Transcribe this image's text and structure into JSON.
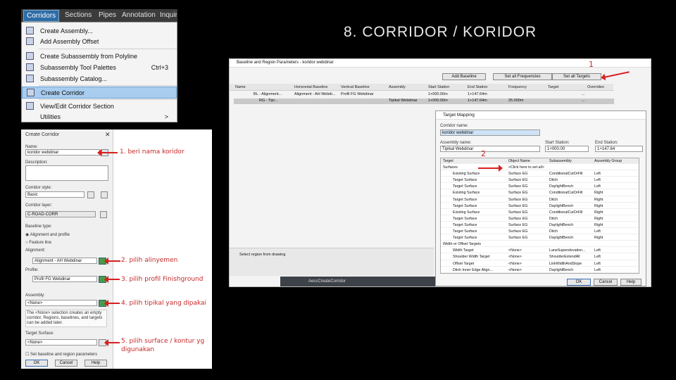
{
  "slide_title": "8. CORRIDOR / KORIDOR",
  "ribbon": {
    "tabs": [
      "Corridors",
      "Sections",
      "Pipes",
      "Annotation",
      "Inquiry"
    ]
  },
  "menu": {
    "items": [
      {
        "label": "Create Assembly...",
        "shortcut": ""
      },
      {
        "label": "Add Assembly Offset",
        "shortcut": ""
      },
      {
        "label": "Create Subassembly from Polyline",
        "shortcut": ""
      },
      {
        "label": "Subassembly Tool Palettes",
        "shortcut": "Ctrl+3"
      },
      {
        "label": "Subassembly Catalog...",
        "shortcut": ""
      },
      {
        "label": "Create Corridor",
        "shortcut": ""
      },
      {
        "label": "View/Edit Corridor Section",
        "shortcut": ""
      },
      {
        "label": "Utilities",
        "shortcut": ">"
      }
    ]
  },
  "create_corridor": {
    "title": "Create Corridor",
    "name_label": "Name:",
    "name_value": "koridor webdinar",
    "description_label": "Description:",
    "style_label": "Corridor style:",
    "style_value": "Basic",
    "layer_label": "Corridor layer:",
    "layer_value": "C-ROAD-CORR",
    "baseline_type_label": "Baseline type:",
    "radio_alignment": "Alignment and profile",
    "radio_feature": "Feature line",
    "alignment_label": "Alignment:",
    "alignment_value": "Alignment - AH Webdinar",
    "profile_label": "Profile:",
    "profile_value": "Profil FG Webdinar",
    "assembly_label": "Assembly:",
    "assembly_value": "<None>",
    "assembly_note": "The <None> selection creates an empty corridor. Regions, baselines, and targets can be added later.",
    "target_label": "Target Surface:",
    "target_value": "<None>",
    "checkbox_label": "Set baseline and region parameters",
    "ok": "OK",
    "cancel": "Cancel",
    "help": "Help"
  },
  "notes": [
    "1. beri nama koridor",
    "2. pilih alinyemen",
    "3. pilih profil Finishground",
    "4. pilih tipikal yang dipakai",
    "5. pilih surface / kontur yg",
    "digunakan"
  ],
  "baseline": {
    "title": "Baseline and Region Parameters - koridor webdinar",
    "buttons": [
      "Add Baseline",
      "Set all Frequencies",
      "Set all Targets"
    ],
    "columns": [
      "Name",
      "Horizontal Baseline",
      "Vertical Baseline",
      "Assembly",
      "Start Station",
      "End Station",
      "Frequency",
      "Target",
      "Overrides"
    ],
    "rows": [
      [
        "BL - Alignment...",
        "Alignment - AH Webdi...",
        "Profil FG Webdinar",
        "",
        "1+000.00m",
        "1+147.64m",
        "",
        "...",
        ""
      ],
      [
        "RG - Tipi...",
        "",
        "",
        "Tipikal Webdinar",
        "1+000.00m",
        "1+147.64m",
        "25.000m",
        "...",
        ""
      ]
    ],
    "side_label": "Select region from drawing",
    "command_line": "AeccCreateCorridor",
    "step1": "1"
  },
  "target_mapping": {
    "title": "Target Mapping",
    "corridor_name_label": "Corridor name:",
    "corridor_name": "koridor webdinar",
    "assembly_name_label": "Assembly name:",
    "assembly_name": "Tipikal Webdinar",
    "start_label": "Start Station:",
    "start_value": "1+000.00",
    "end_label": "End Station:",
    "end_value": "1+147.64",
    "step2": "2",
    "headers": [
      "Target",
      "Object Name",
      "Subassembly",
      "Assembly Group"
    ],
    "rows": [
      [
        "Surfaces",
        "<Click here to set all>",
        "",
        ""
      ],
      [
        "Existing Surface",
        "Surface EG",
        "ConditionalCutOrFill",
        "Left"
      ],
      [
        "Target Surface",
        "Surface EG",
        "Ditch",
        "Left"
      ],
      [
        "Target Surface",
        "Surface EG",
        "DaylightBench",
        "Left"
      ],
      [
        "Existing Surface",
        "Surface EG",
        "ConditionalCutOrFill",
        "Right"
      ],
      [
        "Target Surface",
        "Surface EG",
        "Ditch",
        "Right"
      ],
      [
        "Target Surface",
        "Surface EG",
        "DaylightBench",
        "Right"
      ],
      [
        "Existing Surface",
        "Surface EG",
        "ConditionalCutOrFill",
        "Right"
      ],
      [
        "Target Surface",
        "Surface EG",
        "Ditch",
        "Right"
      ],
      [
        "Target Surface",
        "Surface EG",
        "DaylightBench",
        "Right"
      ],
      [
        "Target Surface",
        "Surface EG",
        "Ditch",
        "Left"
      ],
      [
        "Target Surface",
        "Surface EG",
        "DaylightBench",
        "Right"
      ],
      [
        "Width or Offset Targets",
        "",
        "",
        ""
      ],
      [
        "Width Target",
        "<None>",
        "LaneSuperelevation...",
        "Left"
      ],
      [
        "Shoulder Width Target",
        "<None>",
        "ShoulderExtendAll",
        "Left"
      ],
      [
        "Offset Target",
        "<None>",
        "LinkWidthAndSlope",
        "Left"
      ],
      [
        "Ditch Inner Edge Align...",
        "<None>",
        "DaylightBench",
        "Left"
      ]
    ],
    "ok": "OK",
    "cancel": "Cancel",
    "help": "Help"
  }
}
